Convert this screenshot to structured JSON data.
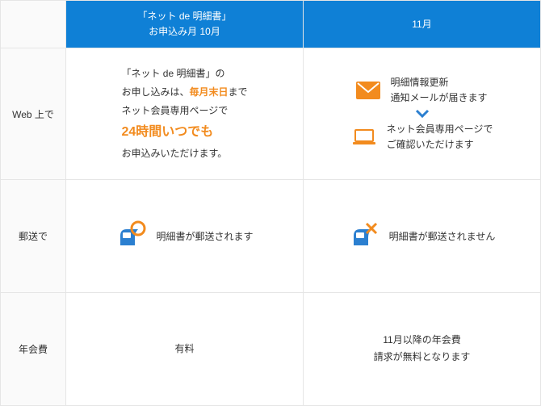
{
  "headers": {
    "rowhead": "",
    "col1_line1": "「ネット de 明細書」",
    "col1_line2": "お申込み月 10月",
    "col2": "11月"
  },
  "rows": {
    "web": {
      "label": "Web 上で",
      "left": {
        "l1a": "「ネット de 明細書」の",
        "l2a": "お申し込みは、",
        "l2b": "毎月末日",
        "l2c": "まで",
        "l3": "ネット会員専用ページで",
        "l4": "24時間いつでも",
        "l5": "お申込みいただけます。"
      },
      "right": {
        "step1_l1": "明細情報更新",
        "step1_l2": "通知メールが届きます",
        "step2_l1": "ネット会員専用ページで",
        "step2_l2": "ご確認いただけます"
      }
    },
    "mail": {
      "label": "郵送で",
      "left": "明細書が郵送されます",
      "right": "明細書が郵送されません"
    },
    "fee": {
      "label": "年会費",
      "left": "有料",
      "right_l1": "11月以降の年会費",
      "right_l2": "請求が無料となります"
    }
  }
}
